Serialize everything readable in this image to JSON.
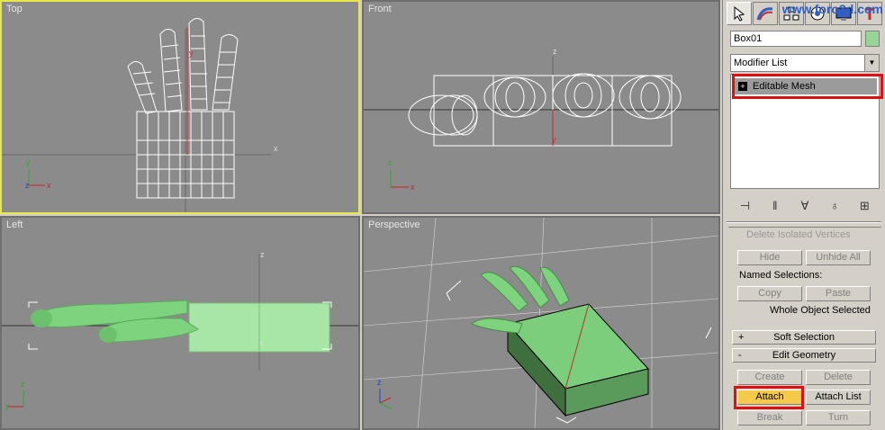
{
  "viewports": {
    "top": {
      "label": "Top"
    },
    "front": {
      "label": "Front"
    },
    "left": {
      "label": "Left"
    },
    "perspective": {
      "label": "Perspective"
    }
  },
  "axes": {
    "x": "x",
    "y": "y",
    "z": "z"
  },
  "command_panel": {
    "watermark": "www.foro3d.com",
    "tab_icons": [
      "create-icon",
      "modify-icon",
      "hierarchy-icon",
      "motion-icon",
      "display-icon",
      "utilities-icon"
    ],
    "object_name": "Box01",
    "object_color": "#96d596",
    "modifier_list": "Modifier List",
    "stack": [
      {
        "label": "Editable Mesh",
        "sign": "+"
      }
    ],
    "rollouts": {
      "delete_isolated": "Delete Isolated Vertices",
      "hide": "Hide",
      "unhide_all": "Unhide All",
      "named_selections": "Named Selections:",
      "copy": "Copy",
      "paste": "Paste",
      "whole_object": "Whole Object Selected",
      "soft_selection": {
        "sign": "+",
        "label": "Soft Selection"
      },
      "edit_geometry": {
        "sign": "-",
        "label": "Edit Geometry"
      },
      "create": "Create",
      "delete": "Delete",
      "attach": "Attach",
      "attach_list": "Attach List",
      "break": "Break",
      "turn": "Turn"
    }
  },
  "colors": {
    "highlight_red": "#e01010",
    "active_viewport": "#e8e84a",
    "attach_button": "#f5c94a",
    "mesh_green": "#96d596"
  }
}
